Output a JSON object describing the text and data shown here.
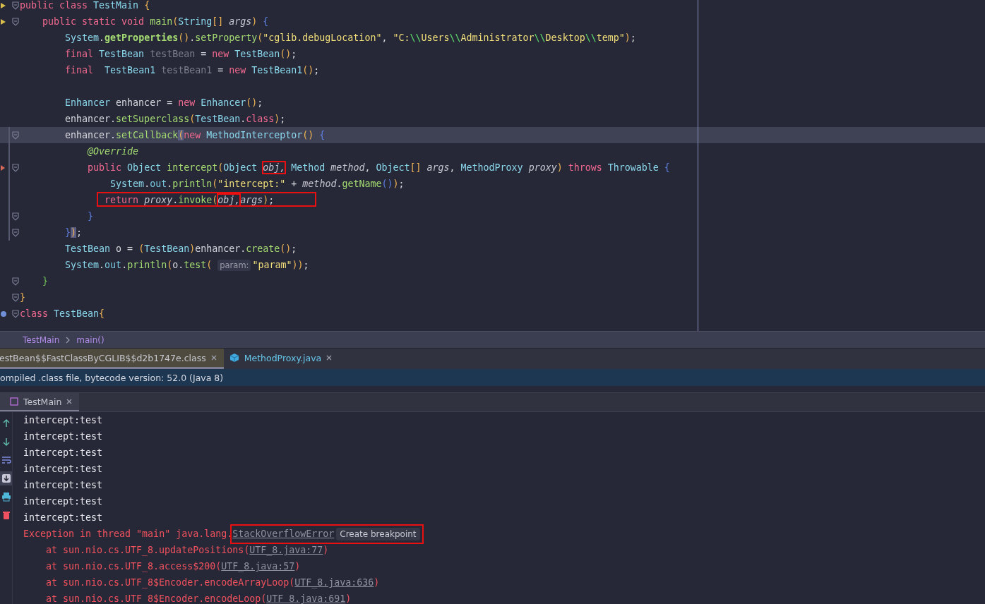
{
  "editor": {
    "lines": [
      {
        "run": true,
        "fold": true,
        "tokens": [
          {
            "kind": "kw",
            "text": "public class "
          },
          {
            "kind": "type",
            "text": "TestMain "
          },
          {
            "kind": "paren",
            "text": "{"
          }
        ]
      },
      {
        "run": true,
        "fold": true,
        "tokens": [
          {
            "kind": "kw",
            "text": "    public static void "
          },
          {
            "kind": "fn",
            "text": "main"
          },
          {
            "kind": "paren",
            "text": "("
          },
          {
            "kind": "type",
            "text": "String"
          },
          {
            "kind": "paren",
            "text": "[] "
          },
          {
            "kind": "param",
            "text": "args"
          },
          {
            "kind": "paren",
            "text": ")"
          },
          {
            "kind": "brace",
            "text": " {"
          }
        ]
      },
      {
        "fold": false,
        "tokens": [
          {
            "kind": "type",
            "text": "        System"
          },
          {
            "kind": "plain",
            "text": "."
          },
          {
            "kind": "fnbold",
            "text": "getProperties"
          },
          {
            "kind": "paren",
            "text": "()"
          },
          {
            "kind": "plain",
            "text": "."
          },
          {
            "kind": "fn",
            "text": "setProperty"
          },
          {
            "kind": "paren",
            "text": "("
          },
          {
            "kind": "str",
            "text": "\"cglib.debugLocation\""
          },
          {
            "kind": "plain",
            "text": ", "
          },
          {
            "kind": "str",
            "text": "\"C:"
          },
          {
            "kind": "esc",
            "text": "\\\\"
          },
          {
            "kind": "str",
            "text": "Users"
          },
          {
            "kind": "esc",
            "text": "\\\\"
          },
          {
            "kind": "str",
            "text": "Administrator"
          },
          {
            "kind": "esc",
            "text": "\\\\"
          },
          {
            "kind": "str",
            "text": "Desktop"
          },
          {
            "kind": "esc",
            "text": "\\\\"
          },
          {
            "kind": "str",
            "text": "temp\""
          },
          {
            "kind": "paren",
            "text": ")"
          },
          {
            "kind": "plain",
            "text": ";"
          }
        ]
      },
      {
        "fold": false,
        "tokens": [
          {
            "kind": "kw",
            "text": "        final "
          },
          {
            "kind": "type",
            "text": "TestBean "
          },
          {
            "kind": "unused",
            "text": "testBean"
          },
          {
            "kind": "plain",
            "text": " = "
          },
          {
            "kind": "kw",
            "text": "new "
          },
          {
            "kind": "type",
            "text": "TestBean"
          },
          {
            "kind": "paren",
            "text": "()"
          },
          {
            "kind": "plain",
            "text": ";"
          }
        ]
      },
      {
        "fold": false,
        "tokens": [
          {
            "kind": "kw",
            "text": "        final  "
          },
          {
            "kind": "type",
            "text": "TestBean1 "
          },
          {
            "kind": "unused",
            "text": "testBean1"
          },
          {
            "kind": "plain",
            "text": " = "
          },
          {
            "kind": "kw",
            "text": "new "
          },
          {
            "kind": "type",
            "text": "TestBean1"
          },
          {
            "kind": "paren",
            "text": "()"
          },
          {
            "kind": "plain",
            "text": ";"
          }
        ]
      },
      {
        "fold": false
      },
      {
        "fold": false,
        "tokens": [
          {
            "kind": "type",
            "text": "        Enhancer "
          },
          {
            "kind": "plain",
            "text": "enhancer = "
          },
          {
            "kind": "kw",
            "text": "new "
          },
          {
            "kind": "type",
            "text": "Enhancer"
          },
          {
            "kind": "paren",
            "text": "()"
          },
          {
            "kind": "plain",
            "text": ";"
          }
        ]
      },
      {
        "fold": false,
        "tokens": [
          {
            "kind": "plain",
            "text": "        enhancer."
          },
          {
            "kind": "fn",
            "text": "setSuperclass"
          },
          {
            "kind": "paren",
            "text": "("
          },
          {
            "kind": "type",
            "text": "TestBean"
          },
          {
            "kind": "plain",
            "text": "."
          },
          {
            "kind": "kw",
            "text": "class"
          },
          {
            "kind": "paren",
            "text": ")"
          },
          {
            "kind": "plain",
            "text": ";"
          }
        ]
      },
      {
        "current": true,
        "changed": true,
        "fold": true,
        "tokens": [
          {
            "kind": "plain",
            "text": "        enhancer."
          },
          {
            "kind": "fn",
            "text": "setCallback"
          },
          {
            "kind": "match",
            "text": "("
          },
          {
            "kind": "kw",
            "text": "new "
          },
          {
            "kind": "type",
            "text": "MethodInterceptor"
          },
          {
            "kind": "paren",
            "text": "()"
          },
          {
            "kind": "brace",
            "text": " {"
          }
        ]
      },
      {
        "changed": true,
        "fold": false,
        "tokens": [
          {
            "kind": "annot",
            "text": "            @Override"
          }
        ]
      },
      {
        "changed": true,
        "override": true,
        "fold": true,
        "tokens": [
          {
            "kind": "kw",
            "text": "            public "
          },
          {
            "kind": "type",
            "text": "Object "
          },
          {
            "kind": "fn",
            "text": "intercept"
          },
          {
            "kind": "paren",
            "text": "("
          },
          {
            "kind": "type",
            "text": "Object "
          },
          {
            "kind": "param",
            "text": "obj,",
            "boxed": true
          },
          {
            "kind": "type",
            "text": " Method "
          },
          {
            "kind": "param",
            "text": "method"
          },
          {
            "kind": "plain",
            "text": ", "
          },
          {
            "kind": "type",
            "text": "Object"
          },
          {
            "kind": "paren",
            "text": "[] "
          },
          {
            "kind": "param",
            "text": "args"
          },
          {
            "kind": "plain",
            "text": ", "
          },
          {
            "kind": "type",
            "text": "MethodProxy "
          },
          {
            "kind": "param",
            "text": "proxy"
          },
          {
            "kind": "paren",
            "text": ")"
          },
          {
            "kind": "kw",
            "text": " throws "
          },
          {
            "kind": "type",
            "text": "Throwable "
          },
          {
            "kind": "brace",
            "text": "{"
          }
        ]
      },
      {
        "changed": true,
        "fold": false,
        "tokens": [
          {
            "kind": "type",
            "text": "                System"
          },
          {
            "kind": "plain",
            "text": "."
          },
          {
            "kind": "field",
            "text": "out"
          },
          {
            "kind": "plain",
            "text": "."
          },
          {
            "kind": "fn",
            "text": "println"
          },
          {
            "kind": "paren",
            "text": "("
          },
          {
            "kind": "str",
            "text": "\"intercept:\""
          },
          {
            "kind": "plain",
            "text": " + "
          },
          {
            "kind": "param",
            "text": "method"
          },
          {
            "kind": "plain",
            "text": "."
          },
          {
            "kind": "fn",
            "text": "getName"
          },
          {
            "kind": "brace",
            "text": "()"
          },
          {
            "kind": "paren",
            "text": ")"
          },
          {
            "kind": "plain",
            "text": ";"
          }
        ]
      },
      {
        "changed": true,
        "boxed": true,
        "fold": false,
        "tokens": [
          {
            "kind": "kw",
            "text": "               return "
          },
          {
            "kind": "param",
            "text": "proxy"
          },
          {
            "kind": "plain",
            "text": "."
          },
          {
            "kind": "fn",
            "text": "invoke"
          },
          {
            "kind": "paren",
            "text": "("
          },
          {
            "kind": "param",
            "text": "obj,",
            "boxed": true
          },
          {
            "kind": "param",
            "text": "args"
          },
          {
            "kind": "paren",
            "text": ")"
          },
          {
            "kind": "plain",
            "text": ";"
          }
        ]
      },
      {
        "changed": true,
        "fold": true,
        "tokens": [
          {
            "kind": "brace",
            "text": "            }"
          }
        ]
      },
      {
        "changed": true,
        "fold": true,
        "tokens": [
          {
            "kind": "brace",
            "text": "        }"
          },
          {
            "kind": "match",
            "text": ")"
          },
          {
            "kind": "plain",
            "text": ";"
          }
        ]
      },
      {
        "fold": false,
        "tokens": [
          {
            "kind": "type",
            "text": "        TestBean "
          },
          {
            "kind": "plain",
            "text": "o = "
          },
          {
            "kind": "paren",
            "text": "("
          },
          {
            "kind": "type",
            "text": "TestBean"
          },
          {
            "kind": "paren",
            "text": ")"
          },
          {
            "kind": "plain",
            "text": "enhancer."
          },
          {
            "kind": "fn",
            "text": "create"
          },
          {
            "kind": "paren",
            "text": "()"
          },
          {
            "kind": "plain",
            "text": ";"
          }
        ]
      },
      {
        "fold": false,
        "tokens": [
          {
            "kind": "type",
            "text": "        System"
          },
          {
            "kind": "plain",
            "text": "."
          },
          {
            "kind": "field",
            "text": "out"
          },
          {
            "kind": "plain",
            "text": "."
          },
          {
            "kind": "fn",
            "text": "println"
          },
          {
            "kind": "paren",
            "text": "("
          },
          {
            "kind": "plain",
            "text": "o."
          },
          {
            "kind": "fn",
            "text": "test"
          },
          {
            "kind": "paren",
            "text": "( "
          },
          {
            "kind": "hint",
            "text": "param:"
          },
          {
            "kind": "str",
            "text": "\"param\""
          },
          {
            "kind": "paren",
            "text": "))"
          },
          {
            "kind": "plain",
            "text": ";"
          }
        ]
      },
      {
        "fold": true,
        "tokens": [
          {
            "kind": "method-brace",
            "text": "    }"
          }
        ]
      },
      {
        "fold": true,
        "tokens": [
          {
            "kind": "paren",
            "text": "}"
          }
        ]
      },
      {
        "implemented": true,
        "fold": true,
        "tokens": [
          {
            "kind": "kw",
            "text": "class "
          },
          {
            "kind": "type",
            "text": "TestBean"
          },
          {
            "kind": "paren",
            "text": "{"
          }
        ]
      }
    ]
  },
  "breadcrumbs": [
    "TestMain",
    "main()"
  ],
  "editor_tabs": [
    {
      "label": "estBean$$FastClassByCGLIB$$d2b1747e.class",
      "selected": true,
      "kind": "class"
    },
    {
      "label": "MethodProxy.java",
      "selected": false,
      "kind": "java"
    }
  ],
  "banner": "ompiled .class file, bytecode version: 52.0 (Java 8)",
  "run_tabs": [
    {
      "label": "TestMain",
      "selected": true
    }
  ],
  "console": {
    "toolbar": [
      {
        "kind": "up",
        "selected": false
      },
      {
        "kind": "down",
        "selected": false
      },
      {
        "kind": "wrap",
        "selected": false
      },
      {
        "kind": "scroll-end",
        "selected": true
      },
      {
        "kind": "print",
        "selected": false
      },
      {
        "kind": "trash",
        "selected": false
      }
    ],
    "lines": [
      {
        "kind": "out",
        "text": "intercept:test"
      },
      {
        "kind": "out",
        "text": "intercept:test"
      },
      {
        "kind": "out",
        "text": "intercept:test"
      },
      {
        "kind": "out",
        "text": "intercept:test"
      },
      {
        "kind": "out",
        "text": "intercept:test"
      },
      {
        "kind": "out",
        "text": "intercept:test"
      },
      {
        "kind": "out",
        "text": "intercept:test"
      },
      {
        "kind": "error",
        "text": "Exception in thread \"main\" java.lang.",
        "link": "StackOverflowError",
        "hint": "Create breakpoint",
        "boxed": true
      },
      {
        "kind": "trace",
        "text": "at sun.nio.cs.UTF_8.updatePositions(",
        "link": "UTF_8.java:77",
        "after": ")"
      },
      {
        "kind": "trace",
        "text": "at sun.nio.cs.UTF_8.access$200(",
        "link": "UTF_8.java:57",
        "after": ")"
      },
      {
        "kind": "trace",
        "text": "at sun.nio.cs.UTF_8$Encoder.encodeArrayLoop(",
        "link": "UTF_8.java:636",
        "after": ")"
      },
      {
        "kind": "trace",
        "text": "at sun.nio.cs.UTF_8$Encoder.encodeLoop(",
        "link": "UTF_8.java:691",
        "after": ")"
      }
    ]
  }
}
